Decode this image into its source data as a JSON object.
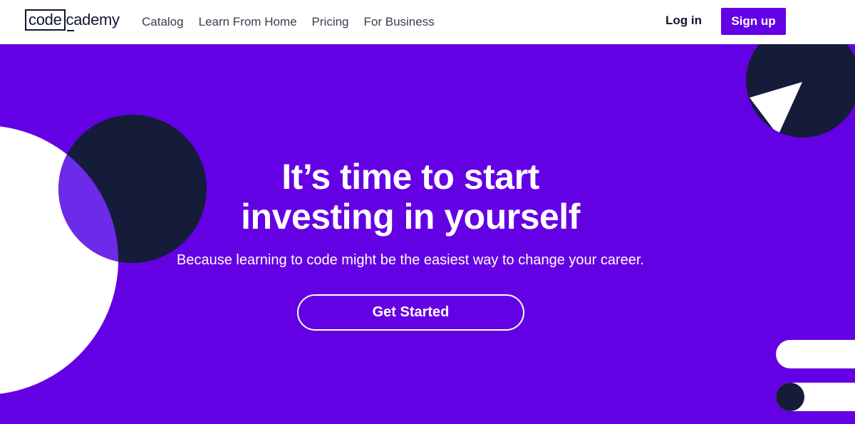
{
  "header": {
    "logo": {
      "boxed": "code",
      "rest": "cademy"
    },
    "nav": [
      {
        "label": "Catalog"
      },
      {
        "label": "Learn From Home"
      },
      {
        "label": "Pricing"
      },
      {
        "label": "For Business"
      }
    ],
    "login_label": "Log in",
    "signup_label": "Sign up"
  },
  "hero": {
    "headline_line1": "It’s time to start",
    "headline_line2": "investing in yourself",
    "subheadline": "Because learning to code might be the easiest way to change your career.",
    "cta_label": "Get Started"
  },
  "colors": {
    "brand_purple": "#6400e4",
    "navy": "#141c3a",
    "white": "#ffffff"
  }
}
